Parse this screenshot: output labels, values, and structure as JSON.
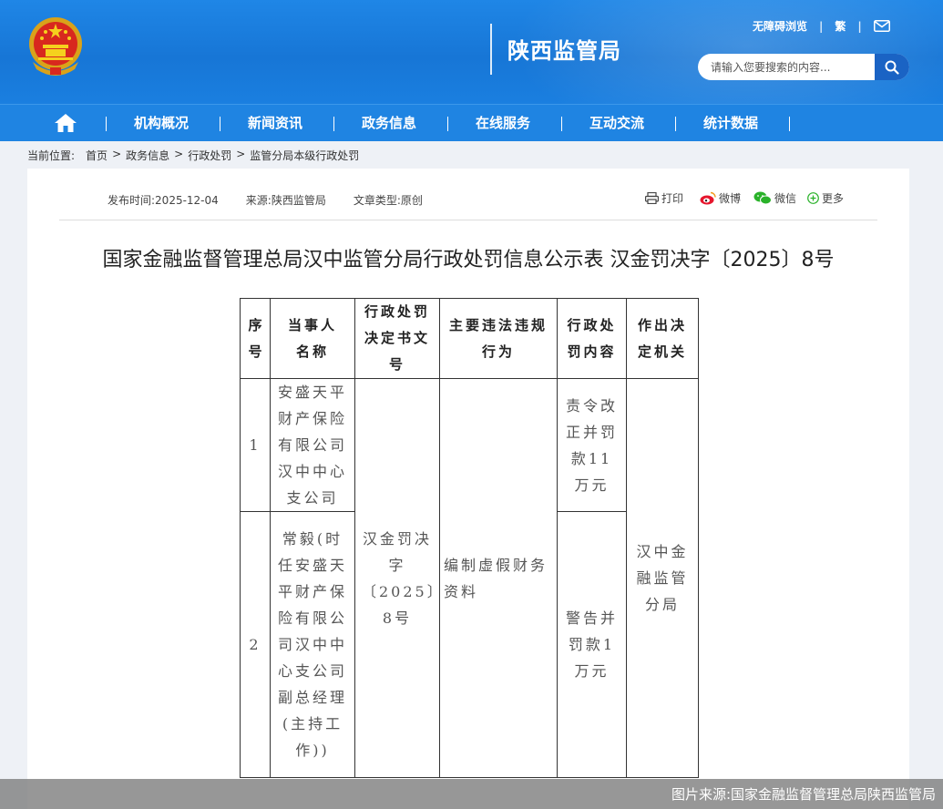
{
  "header": {
    "site_title": "陕西监管局",
    "accessibility_link": "无障碍浏览",
    "traditional_link": "繁",
    "search_placeholder": "请输入您要搜索的内容..."
  },
  "nav": {
    "items": [
      "机构概况",
      "新闻资讯",
      "政务信息",
      "在线服务",
      "互动交流",
      "统计数据"
    ]
  },
  "breadcrumb": {
    "label": "当前位置:",
    "items": [
      "首页",
      "政务信息",
      "行政处罚",
      "监管分局本级行政处罚"
    ],
    "separator": ">"
  },
  "article": {
    "publish_time": "发布时间:2025-12-04",
    "source": "来源:陕西监管局",
    "type": "文章类型:原创",
    "share": {
      "print": "打印",
      "weibo": "微博",
      "wechat": "微信",
      "more": "更多"
    },
    "title": "国家金融监督管理总局汉中监管分局行政处罚信息公示表 汉金罚决字〔2025〕8号"
  },
  "table": {
    "headers": [
      "序号",
      "当事人名称",
      "行政处罚决定书文号",
      "主要违法违规行为",
      "行政处罚内容",
      "作出决定机关"
    ],
    "rows": [
      {
        "no": "1",
        "party": "安盛天平财产保险有限公司汉中中心支公司",
        "penalty": "责令改正并罚款11万元"
      },
      {
        "no": "2",
        "party": "常毅(时任安盛天平财产保险有限公司汉中中心支公司副总经理(主持工作))",
        "penalty": "警告并罚款1万元"
      }
    ],
    "decision_no": "汉金罚决字〔2025〕8号",
    "violation": "编制虚假财务资料",
    "authority": "汉中金融监管分局"
  },
  "caption": "图片来源:国家金融监督管理总局陕西监管局",
  "colors": {
    "header_blue": "#1a7fe0",
    "nav_blue": "#1f84e2",
    "search_btn": "#1a63c4"
  }
}
